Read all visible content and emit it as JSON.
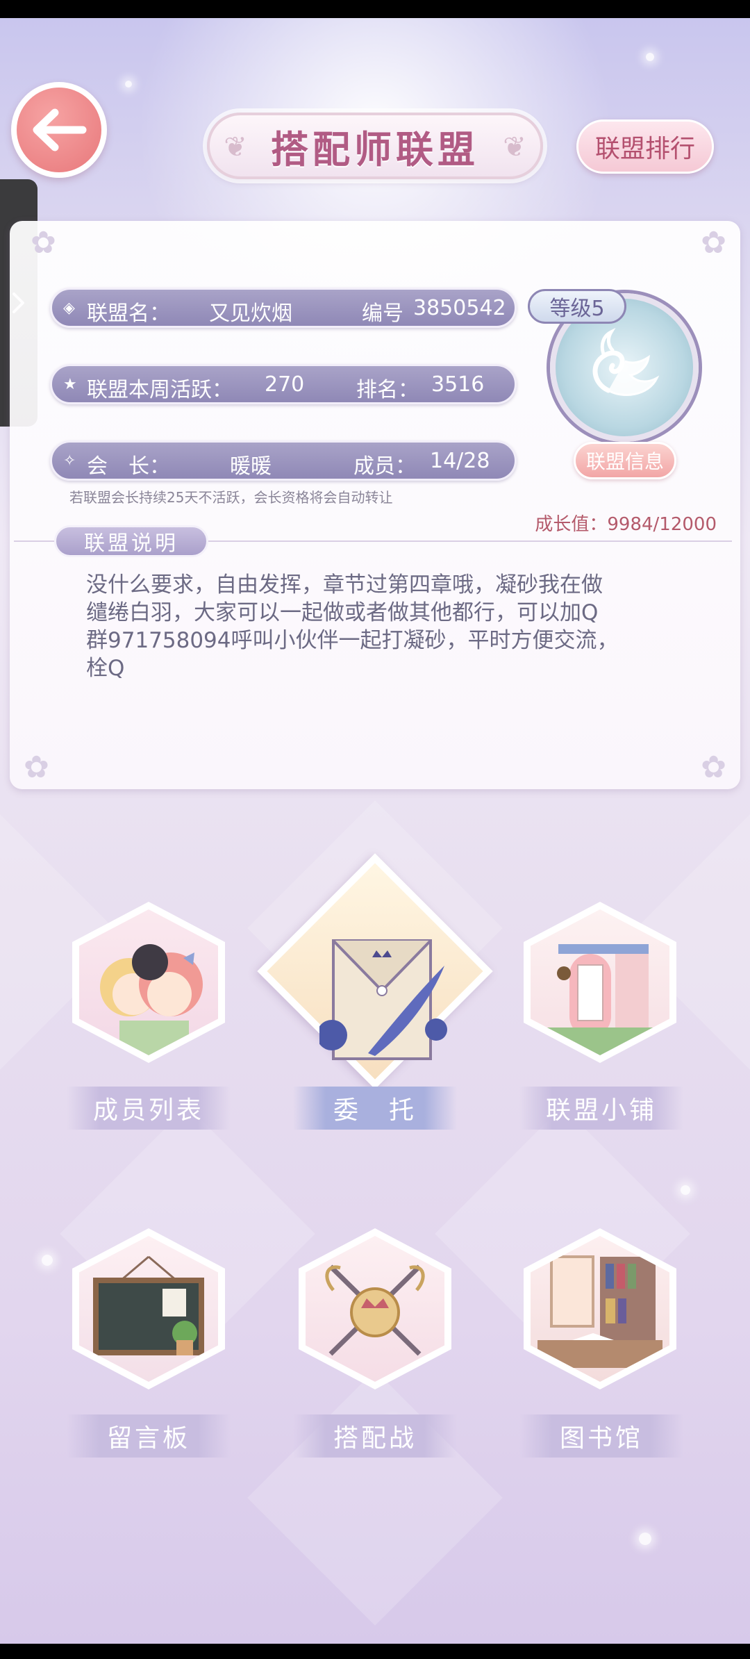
{
  "header": {
    "title": "搭配师联盟",
    "rank_button": "联盟排行"
  },
  "alliance": {
    "name_label": "联盟名：",
    "name_value": "又见炊烟",
    "id_label": "编号",
    "id_value": "3850542",
    "activity_label": "联盟本周活跃：",
    "activity_value": "270",
    "rank_label": "排名：",
    "rank_value": "3516",
    "leader_label": "会　长：",
    "leader_value": "暖暖",
    "members_label": "成员：",
    "members_value": "14/28",
    "level": "等级5",
    "info_button": "联盟信息",
    "notice": "若联盟会长持续25天不活跃，会长资格将会自动转让",
    "growth": "成长值：9984/12000",
    "description_title": "联盟说明",
    "description": "没什么要求，自由发挥，章节过第四章哦，凝砂我在做\n缱绻白羽，大家可以一起做或者做其他都行，可以加Q\n群971758094呼叫小伙伴一起打凝砂，平时方便交流，\n栓Q"
  },
  "menu": {
    "members": "成员列表",
    "commission": "委　托",
    "shop": "联盟小铺",
    "board": "留言板",
    "battle": "搭配战",
    "library": "图书馆"
  },
  "icons": {
    "back": "back-arrow-icon",
    "side": "chevron-right-icon",
    "emblem": "swan-emblem-icon"
  },
  "colors": {
    "title": "#b15b84",
    "pill": "#9b94c0",
    "accent_pink": "#f2a6a6",
    "growth": "#b45a6b"
  }
}
